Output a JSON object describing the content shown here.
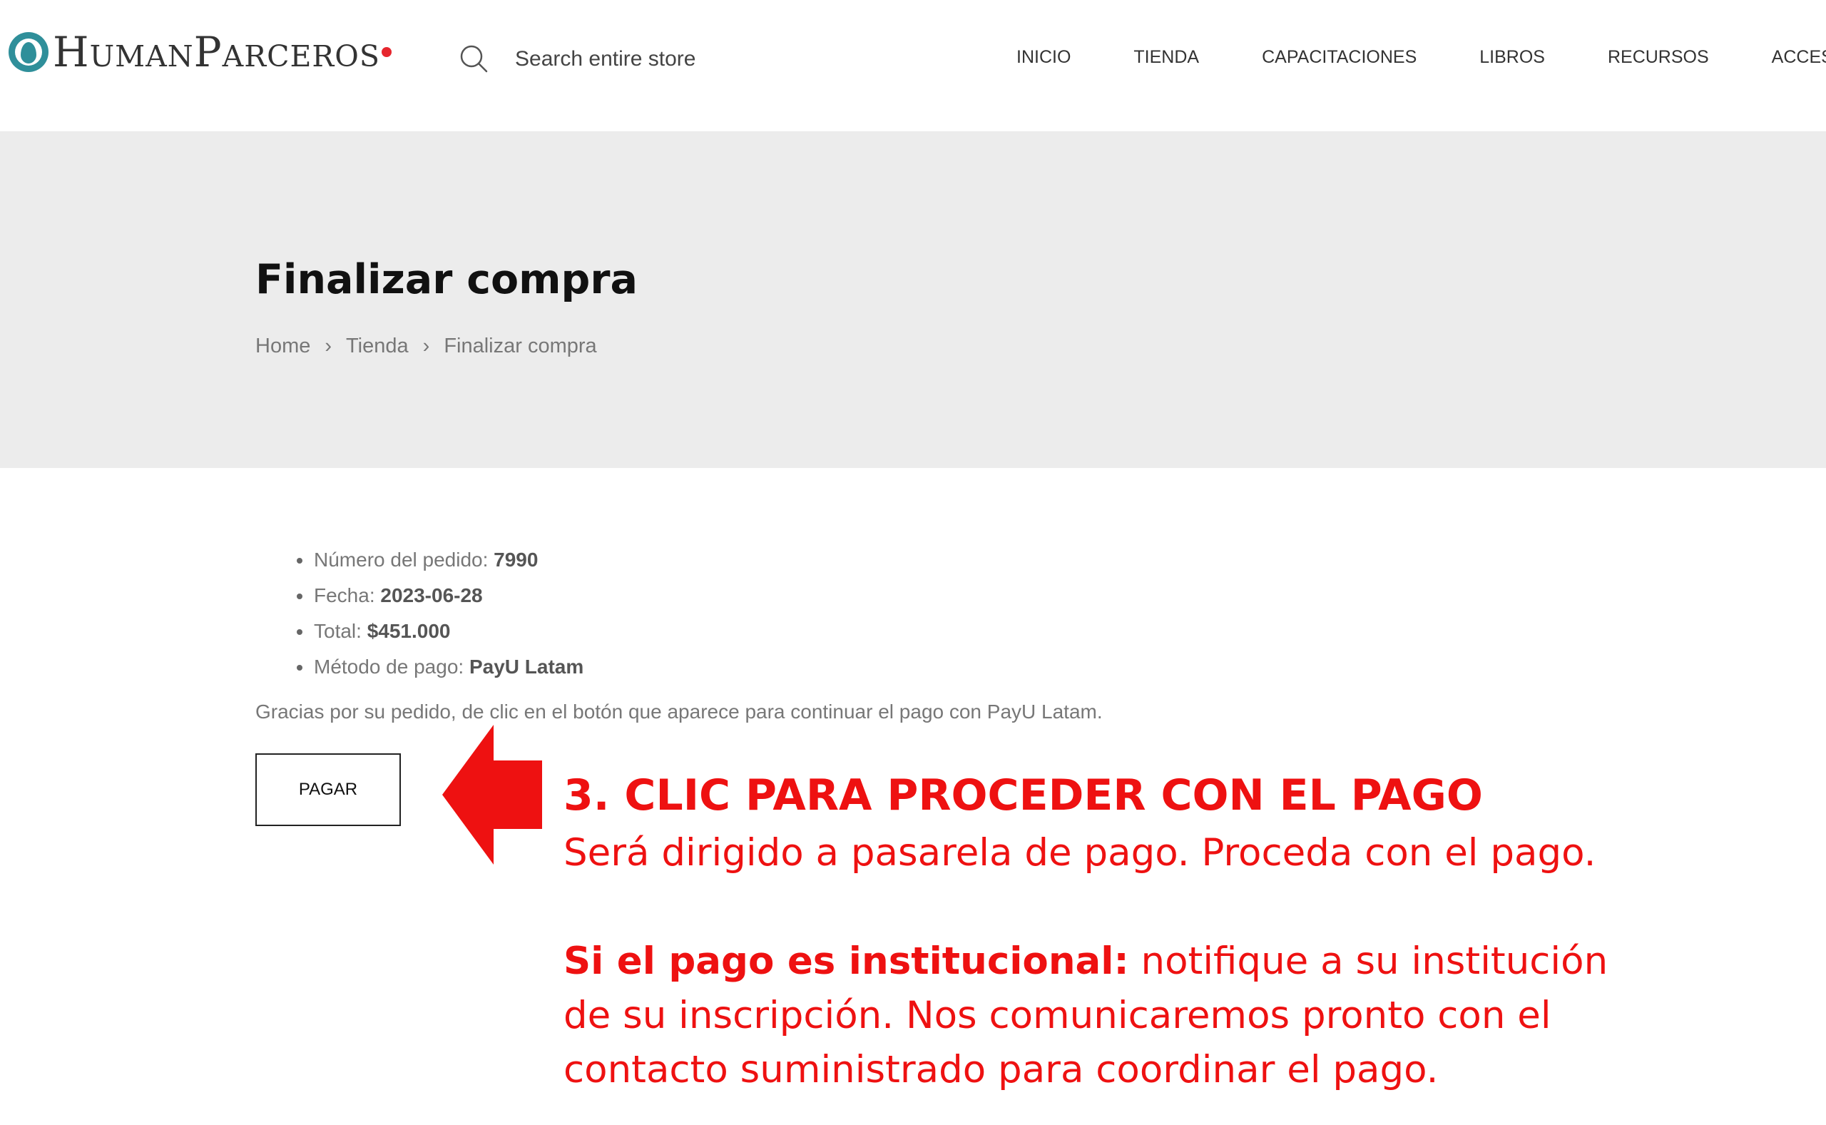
{
  "header": {
    "logo_text": "HumanParceros",
    "search": {
      "placeholder": "Search entire store"
    },
    "nav": [
      "INICIO",
      "TIENDA",
      "CAPACITACIONES",
      "LIBROS",
      "RECURSOS",
      "ACCESORIOS"
    ]
  },
  "page": {
    "title": "Finalizar compra",
    "breadcrumb": [
      "Home",
      "Tienda",
      "Finalizar compra"
    ]
  },
  "order": {
    "items": [
      {
        "label": "Número del pedido:",
        "value": "7990"
      },
      {
        "label": "Fecha:",
        "value": "2023-06-28"
      },
      {
        "label": "Total:",
        "value": "$451.000"
      },
      {
        "label": "Método de pago:",
        "value": "PayU Latam"
      }
    ],
    "thanks_text": "Gracias por su pedido, de clic en el botón que aparece para continuar el pago con PayU Latam.",
    "pay_button_label": "PAGAR"
  },
  "annotation": {
    "title": "3. CLIC PARA PROCEDER CON EL PAGO",
    "line1": "Será dirigido a pasarela de pago. Proceda con el pago.",
    "institutional_bold": "Si el pago es institucional:",
    "institutional_rest": " notifique a su institución",
    "line3": "de su inscripción. Nos comunicaremos pronto con el",
    "line4": "contacto suministrado para coordinar el pago."
  },
  "colors": {
    "accent_red": "#ee1111",
    "logo_teal": "#2f8f9a",
    "band_gray": "#ececec"
  },
  "icons": {
    "search": "search-icon",
    "arrow": "arrow-left-icon",
    "logo": "logo-mark-icon"
  }
}
